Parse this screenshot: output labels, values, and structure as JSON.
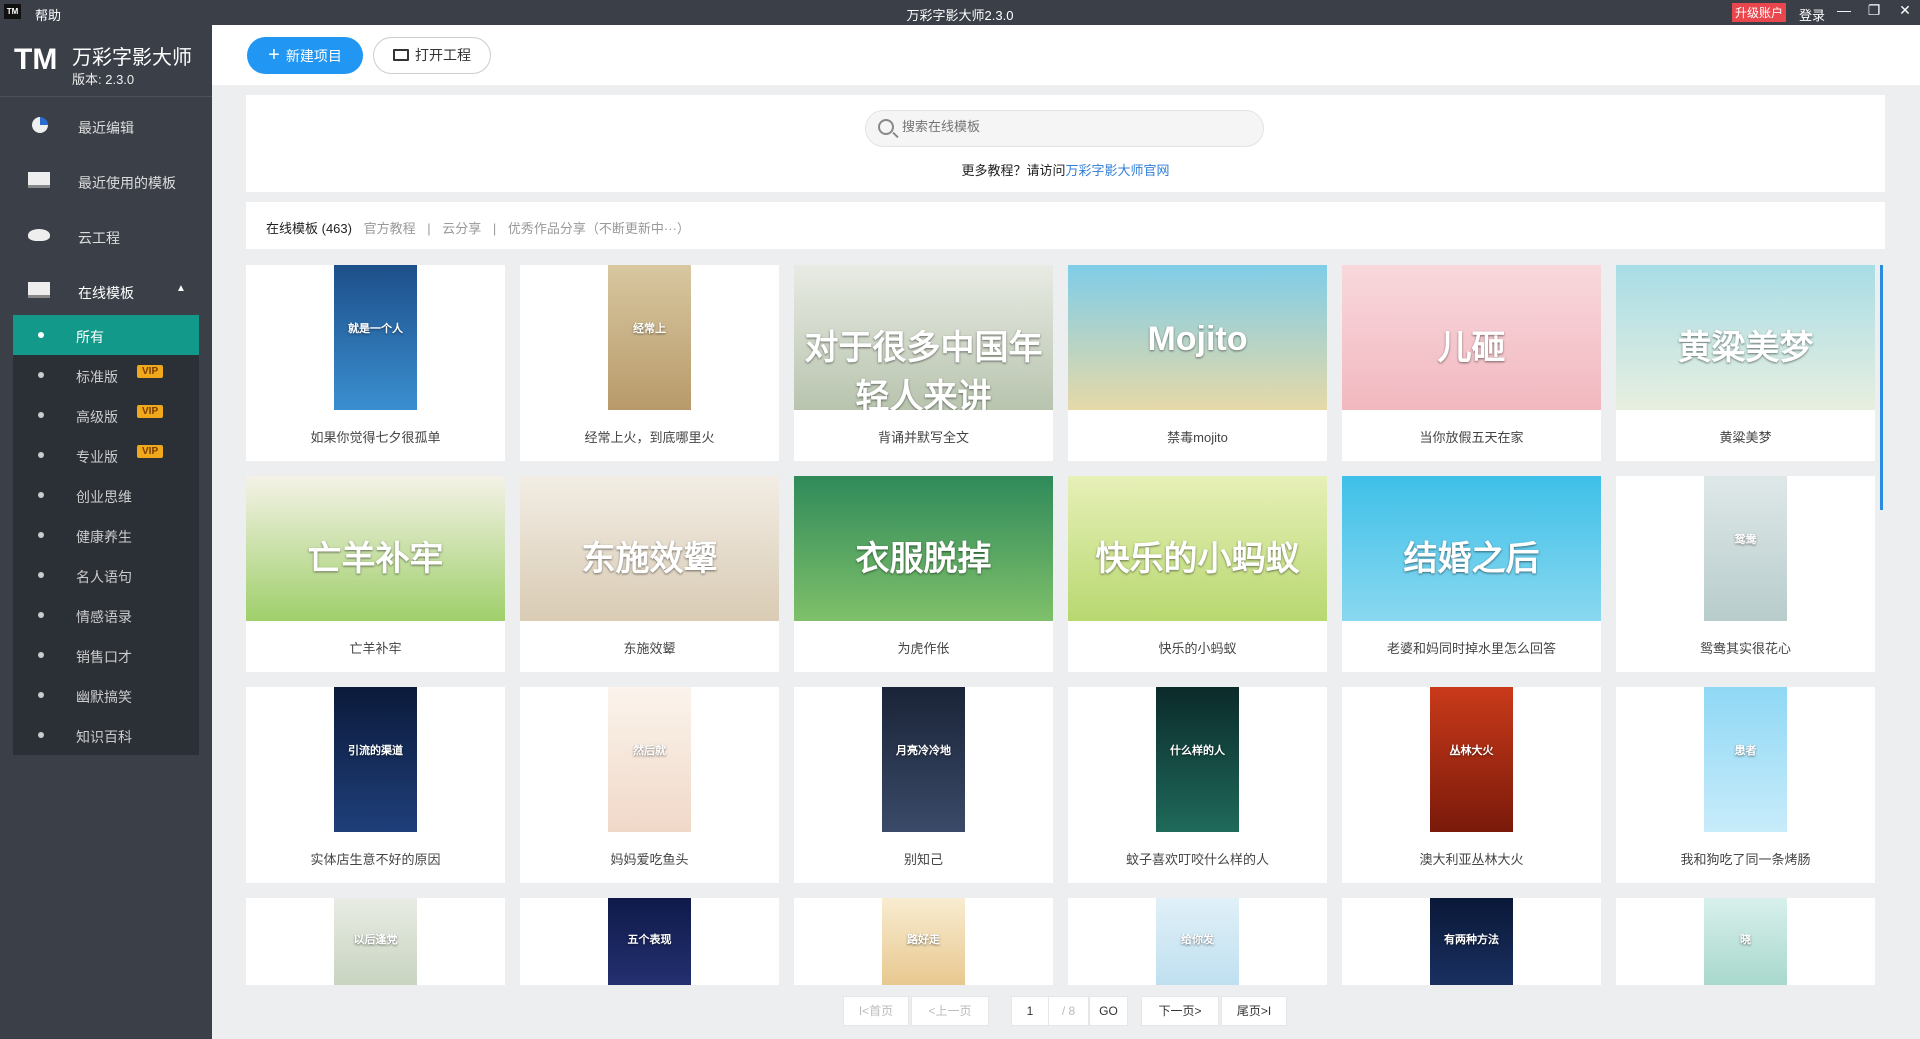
{
  "titlebar": {
    "logo": "TM",
    "help": "帮助",
    "title": "万彩字影大师2.3.0",
    "upgrade": "升级账户",
    "login": "登录",
    "minimize": "—",
    "restore": "❐",
    "close": "✕"
  },
  "brand": {
    "logo": "TM",
    "name": "万彩字影大师",
    "version": "版本: 2.3.0"
  },
  "sidebar": {
    "items": [
      {
        "label": "最近编辑"
      },
      {
        "label": "最近使用的模板"
      },
      {
        "label": "云工程"
      },
      {
        "label": "在线模板"
      }
    ],
    "sub_items": [
      {
        "label": "所有",
        "vip": null
      },
      {
        "label": "标准版",
        "vip": "VIP"
      },
      {
        "label": "高级版",
        "vip": "VIP"
      },
      {
        "label": "专业版",
        "vip": "VIP"
      },
      {
        "label": "创业思维",
        "vip": null
      },
      {
        "label": "健康养生",
        "vip": null
      },
      {
        "label": "名人语句",
        "vip": null
      },
      {
        "label": "情感语录",
        "vip": null
      },
      {
        "label": "销售口才",
        "vip": null
      },
      {
        "label": "幽默搞笑",
        "vip": null
      },
      {
        "label": "知识百科",
        "vip": null
      }
    ]
  },
  "toolbar": {
    "new_project": "新建项目",
    "open_project": "打开工程"
  },
  "search": {
    "placeholder": "搜索在线模板",
    "help_prefix": "更多教程？请访问",
    "help_link": "万彩字影大师官网"
  },
  "tabs": {
    "online": "在线模板 (463)",
    "official": "官方教程",
    "sep": "|",
    "cloud": "云分享",
    "excellent": "优秀作品分享（不断更新中···）"
  },
  "cards": [
    {
      "title": "如果你觉得七夕很孤单",
      "shape": "port",
      "bg": "#1d4f8a",
      "bg2": "#3a8fd0",
      "text": "就是一个人"
    },
    {
      "title": "经常上火，到底哪里火",
      "shape": "port",
      "bg": "#d8c7a0",
      "bg2": "#b89a6a",
      "text": "经常上"
    },
    {
      "title": "背诵并默写全文",
      "shape": "land",
      "bg": "#e8ebe4",
      "bg2": "#b8c4ae",
      "text": "对于很多中国年轻人来讲"
    },
    {
      "title": "禁毒mojito",
      "shape": "land",
      "bg": "#7fcde8",
      "bg2": "#e6d9a8",
      "text": "Mojito"
    },
    {
      "title": "当你放假五天在家",
      "shape": "land",
      "bg": "#f8d8dc",
      "bg2": "#f2b8c0",
      "text": "儿砸"
    },
    {
      "title": "黄粱美梦",
      "shape": "land",
      "bg": "#a8dde6",
      "bg2": "#e8efe0",
      "text": "黄粱美梦"
    },
    {
      "title": "亡羊补牢",
      "shape": "land",
      "bg": "#f5f2e8",
      "bg2": "#9fcf6a",
      "text": "亡羊补牢"
    },
    {
      "title": "东施效颦",
      "shape": "land",
      "bg": "#f2ede4",
      "bg2": "#d9cbb4",
      "text": "东施效颦"
    },
    {
      "title": "为虎作伥",
      "shape": "land",
      "bg": "#2f8a5a",
      "bg2": "#7fc06a",
      "text": "衣服脱掉"
    },
    {
      "title": "快乐的小蚂蚁",
      "shape": "land",
      "bg": "#e7f0b8",
      "bg2": "#b8d870",
      "text": "快乐的小蚂蚁"
    },
    {
      "title": "老婆和妈同时掉水里怎么回答",
      "shape": "land",
      "bg": "#3ec0e8",
      "bg2": "#8ad8f0",
      "text": "结婚之后"
    },
    {
      "title": "鸳鸯其实很花心",
      "shape": "port",
      "bg": "#dfe8e8",
      "bg2": "#b8cccc",
      "text": "鸳鸯"
    },
    {
      "title": "实体店生意不好的原因",
      "shape": "port",
      "bg": "#0b1a3a",
      "bg2": "#1f3f7a",
      "text": "引流的渠道"
    },
    {
      "title": "妈妈爱吃鱼头",
      "shape": "port",
      "bg": "#fbf4ec",
      "bg2": "#f0d8c8",
      "text": "然后就"
    },
    {
      "title": "别知己",
      "shape": "port",
      "bg": "#1a2438",
      "bg2": "#3a4a68",
      "text": "月亮冷冷地"
    },
    {
      "title": "蚊子喜欢叮咬什么样的人",
      "shape": "port",
      "bg": "#0b2a2a",
      "bg2": "#1f6a5a",
      "text": "什么样的人"
    },
    {
      "title": "澳大利亚丛林大火",
      "shape": "port",
      "bg": "#c93a1a",
      "bg2": "#7a1a0a",
      "text": "丛林大火"
    },
    {
      "title": "我和狗吃了同一条烤肠",
      "shape": "port",
      "bg": "#8fd8f5",
      "bg2": "#c8ecfa",
      "text": "患者"
    },
    {
      "title": "",
      "shape": "port",
      "bg": "#e8ece4",
      "bg2": "#c8d4c0",
      "text": "以后逢党"
    },
    {
      "title": "",
      "shape": "port",
      "bg": "#0f1a4a",
      "bg2": "#243070",
      "text": "五个表现"
    },
    {
      "title": "",
      "shape": "port",
      "bg": "#f8ecd0",
      "bg2": "#e8c890",
      "text": "路好走"
    },
    {
      "title": "",
      "shape": "port",
      "bg": "#e0f0f8",
      "bg2": "#c0e0f0",
      "text": "给你发"
    },
    {
      "title": "",
      "shape": "port",
      "bg": "#0a1838",
      "bg2": "#1a3060",
      "text": "有两种方法"
    },
    {
      "title": "",
      "shape": "port",
      "bg": "#d8f0ec",
      "bg2": "#a8d8cc",
      "text": "晓"
    }
  ],
  "pager": {
    "first": "I<首页",
    "prev": "<上一页",
    "current": "1",
    "total": "/ 8",
    "go": "GO",
    "next": "下一页>",
    "last": "尾页>I"
  }
}
